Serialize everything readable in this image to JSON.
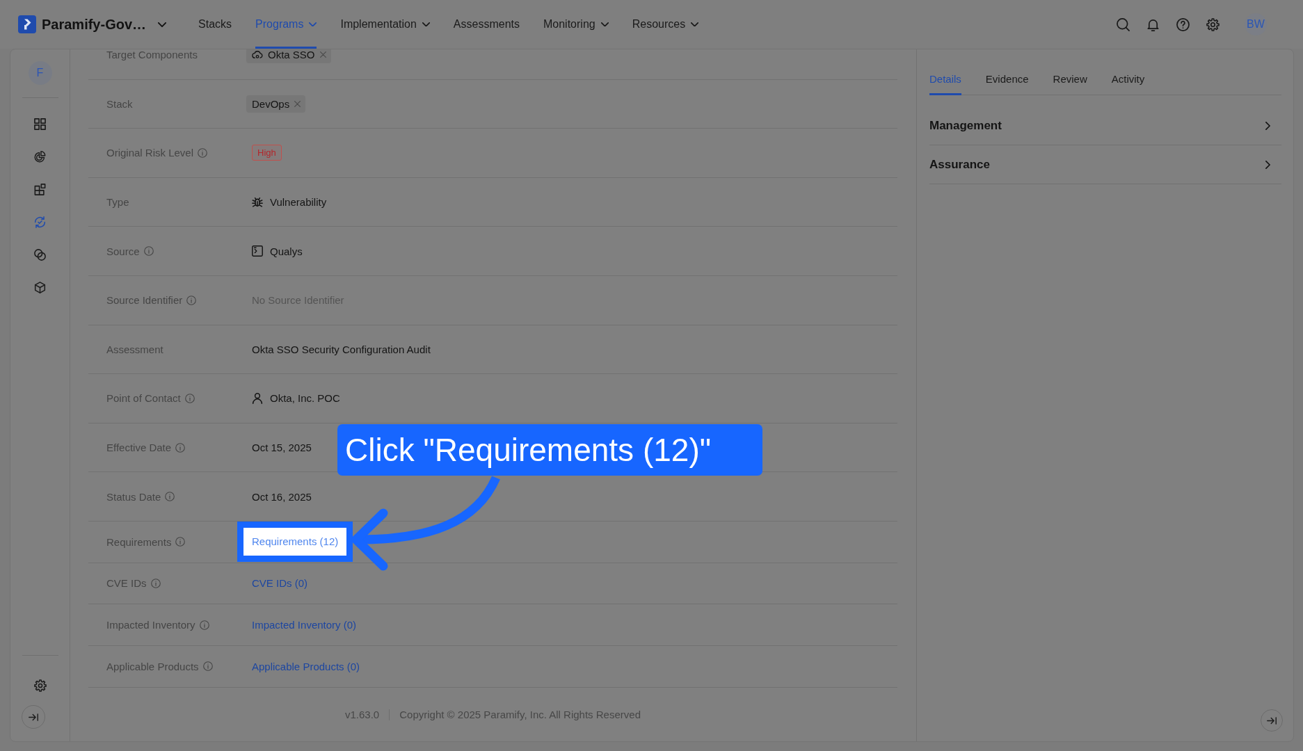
{
  "header": {
    "workspace": "Paramify-Gov…",
    "nav": [
      {
        "label": "Stacks",
        "selected": false,
        "has_menu": false
      },
      {
        "label": "Programs",
        "selected": true,
        "has_menu": true
      },
      {
        "label": "Implementation",
        "selected": false,
        "has_menu": true
      },
      {
        "label": "Assessments",
        "selected": false,
        "has_menu": false
      },
      {
        "label": "Monitoring",
        "selected": false,
        "has_menu": true
      },
      {
        "label": "Resources",
        "selected": false,
        "has_menu": true
      }
    ],
    "user_initials": "BW"
  },
  "sidebar": {
    "workspace_initial": "F",
    "items": [
      {
        "selected": false
      },
      {
        "selected": false
      },
      {
        "selected": false
      },
      {
        "selected": true
      },
      {
        "selected": false
      },
      {
        "selected": false
      }
    ]
  },
  "details": {
    "rows": [
      {
        "label": "Target Components",
        "info": false,
        "kind": "component",
        "value": "Okta SSO"
      },
      {
        "label": "Stack",
        "info": false,
        "kind": "tag",
        "value": "DevOps"
      },
      {
        "label": "Original Risk Level",
        "info": true,
        "kind": "risk",
        "value": "High"
      },
      {
        "label": "Type",
        "info": false,
        "kind": "type",
        "value": "Vulnerability"
      },
      {
        "label": "Source",
        "info": true,
        "kind": "source",
        "value": "Qualys"
      },
      {
        "label": "Source Identifier",
        "info": true,
        "kind": "empty",
        "value": "No Source Identifier"
      },
      {
        "label": "Assessment",
        "info": false,
        "kind": "text",
        "value": "Okta SSO Security Configuration Audit"
      },
      {
        "label": "Point of Contact",
        "info": true,
        "kind": "contact",
        "value": "Okta, Inc. POC"
      },
      {
        "label": "Effective Date",
        "info": true,
        "kind": "text",
        "value": "Oct 15, 2025"
      },
      {
        "label": "Status Date",
        "info": true,
        "kind": "text",
        "value": "Oct 16, 2025"
      },
      {
        "label": "Requirements",
        "info": true,
        "kind": "link",
        "value": "Requirements (12)",
        "highlighted": true
      },
      {
        "label": "CVE IDs",
        "info": true,
        "kind": "link",
        "value": "CVE IDs (0)",
        "highlighted": false
      },
      {
        "label": "Impacted Inventory",
        "info": true,
        "kind": "link",
        "value": "Impacted Inventory (0)",
        "highlighted": false
      },
      {
        "label": "Applicable Products",
        "info": true,
        "kind": "link",
        "value": "Applicable Products (0)",
        "highlighted": false
      }
    ],
    "footer": {
      "version": "v1.63.0",
      "copyright": "Copyright © 2025 Paramify, Inc. All Rights Reserved"
    }
  },
  "panel": {
    "tabs": [
      {
        "label": "Details",
        "selected": true
      },
      {
        "label": "Evidence",
        "selected": false
      },
      {
        "label": "Review",
        "selected": false
      },
      {
        "label": "Activity",
        "selected": false
      }
    ],
    "sections": [
      {
        "title": "Management",
        "expanded": false
      },
      {
        "title": "Assurance",
        "expanded": false
      }
    ]
  },
  "callout": {
    "text": "Click \"Requirements (12)\""
  }
}
